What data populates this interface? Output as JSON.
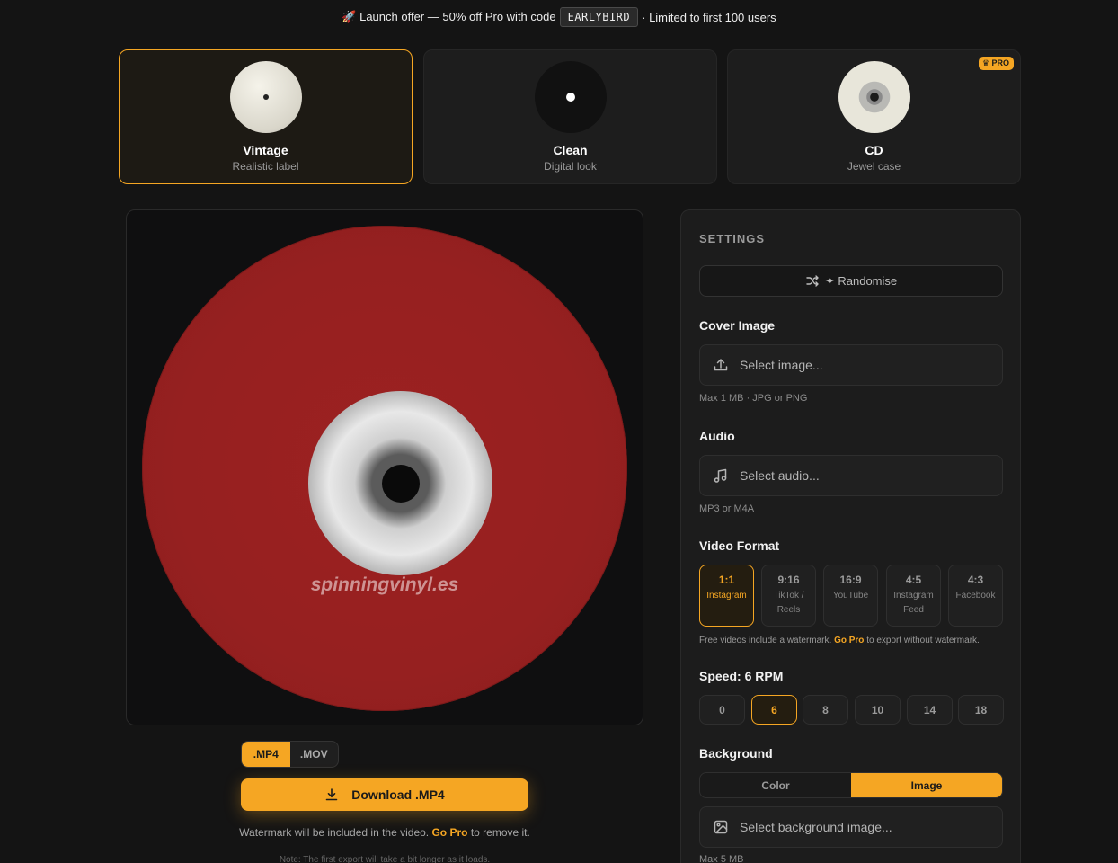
{
  "banner": {
    "prefix": "🚀 Launch offer — 50% off Pro with code",
    "code": "EARLYBIRD",
    "suffix": "· Limited to first 100 users"
  },
  "styles": [
    {
      "name": "Vintage",
      "desc": "Realistic label",
      "selected": true
    },
    {
      "name": "Clean",
      "desc": "Digital look",
      "selected": false
    },
    {
      "name": "CD",
      "desc": "Jewel case",
      "selected": false,
      "badge": "PRO"
    }
  ],
  "preview": {
    "watermark": "spinningvinyl.es",
    "record_color": "#962020"
  },
  "export": {
    "formats": [
      ".MP4",
      ".MOV"
    ],
    "selected_format": ".MP4",
    "download_label": "Download .MP4",
    "watermark_note_prefix": "Watermark will be included in the video.",
    "watermark_note_link": "Go Pro",
    "watermark_note_suffix": "to remove it.",
    "first_export_note": "Note: The first export will take a bit longer as it loads."
  },
  "settings": {
    "title": "SETTINGS",
    "randomise_label": "✦ Randomise",
    "cover_image": {
      "label": "Cover Image",
      "placeholder": "Select image...",
      "hint": "Max 1 MB · JPG or PNG"
    },
    "audio": {
      "label": "Audio",
      "placeholder": "Select audio...",
      "hint": "MP3 or M4A"
    },
    "video_format": {
      "label": "Video Format",
      "options": [
        {
          "ratio": "1:1",
          "platform": "Instagram",
          "selected": true
        },
        {
          "ratio": "9:16",
          "platform": "TikTok / Reels",
          "selected": false
        },
        {
          "ratio": "16:9",
          "platform": "YouTube",
          "selected": false
        },
        {
          "ratio": "4:5",
          "platform": "Instagram Feed",
          "selected": false
        },
        {
          "ratio": "4:3",
          "platform": "Facebook",
          "selected": false
        }
      ],
      "note_prefix": "Free videos include a watermark.",
      "note_link": "Go Pro",
      "note_suffix": "to export without watermark."
    },
    "speed": {
      "label": "Speed: 6 RPM",
      "options": [
        "0",
        "6",
        "8",
        "10",
        "14",
        "18"
      ],
      "selected": "6"
    },
    "background": {
      "label": "Background",
      "options": [
        "Color",
        "Image"
      ],
      "selected": "Image",
      "placeholder": "Select background image...",
      "hint": "Max 5 MB"
    }
  },
  "colors": {
    "accent": "#f5a623",
    "background": "#141414"
  }
}
